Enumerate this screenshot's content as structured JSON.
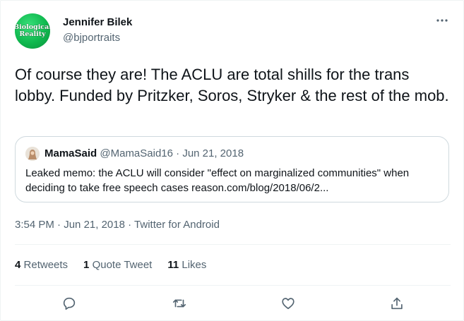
{
  "author": {
    "name": "Jennifer Bilek",
    "handle": "@bjportraits",
    "avatar_text": [
      "Biological",
      "Reality"
    ],
    "avatar_color": "#14c057"
  },
  "tweet": {
    "text": "Of course they are! The ACLU are total shills for the trans lobby. Funded by Pritzker, Soros, Stryker & the rest of the mob."
  },
  "quoted": {
    "name": "MamaSaid",
    "meta": "@MamaSaid16 · Jun 21, 2018",
    "text": "Leaked memo: the ACLU will consider \"effect on marginalized communities\" when deciding to take free speech cases reason.com/blog/2018/06/2..."
  },
  "meta": {
    "time": "3:54 PM",
    "separator": " · ",
    "date": "Jun 21, 2018",
    "source": "Twitter for Android"
  },
  "stats": {
    "retweets_count": "4",
    "retweets_label": "Retweets",
    "quotes_count": "1",
    "quotes_label": "Quote Tweet",
    "likes_count": "11",
    "likes_label": "Likes"
  },
  "actions": {
    "icons": [
      "reply-icon",
      "retweet-icon",
      "like-icon",
      "share-icon"
    ]
  },
  "colors": {
    "text": "#0f1419",
    "secondary": "#536471",
    "border": "#cfd9de",
    "divider": "#eff3f4"
  }
}
